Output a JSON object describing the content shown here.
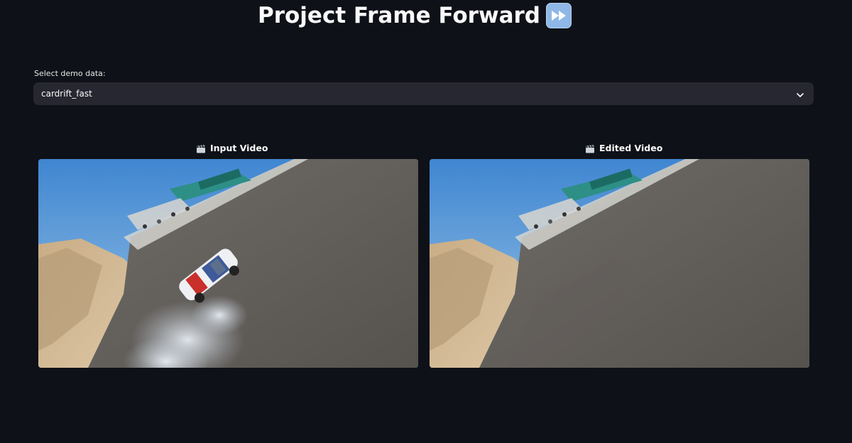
{
  "app": {
    "title": "Project Frame Forward",
    "title_icon": "fast-forward-icon"
  },
  "demo_select": {
    "label": "Select demo data:",
    "value": "cardrift_fast",
    "icon": "chevron-down-icon"
  },
  "columns": [
    {
      "caption": "Input Video",
      "icon": "clapperboard-icon"
    },
    {
      "caption": "Edited Video",
      "icon": "clapperboard-icon"
    }
  ],
  "colors": {
    "background": "#0e1117",
    "select_background": "#262730",
    "text": "#fafafa"
  }
}
